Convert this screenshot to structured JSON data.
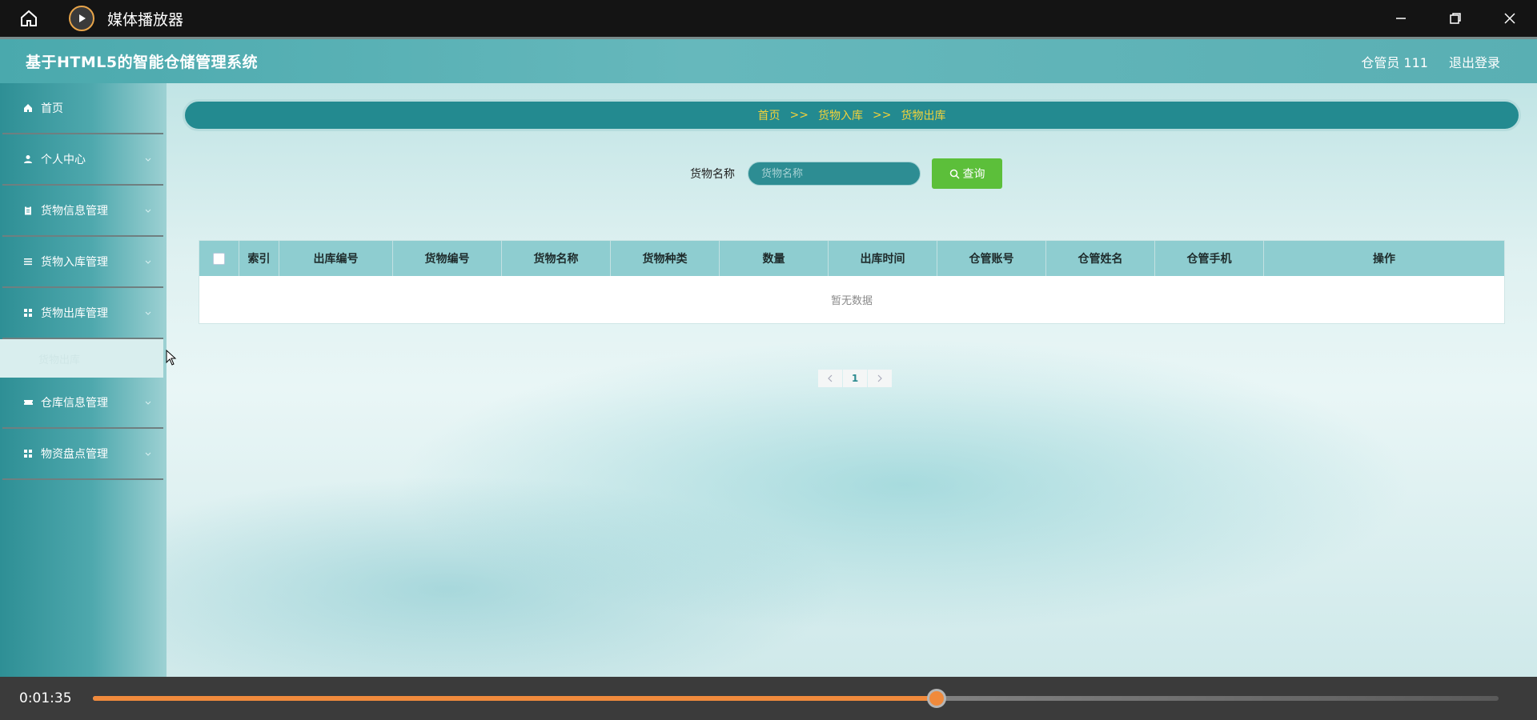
{
  "player": {
    "title": "媒体播放器",
    "time": "0:01:35",
    "progress": 0.6
  },
  "header": {
    "title": "基于HTML5的智能仓储管理系统",
    "user": "仓管员 111",
    "logout": "退出登录"
  },
  "sidebar": {
    "items": [
      {
        "label": "首页",
        "icon": "home-icon"
      },
      {
        "label": "个人中心",
        "icon": "user-icon"
      },
      {
        "label": "货物信息管理",
        "icon": "clipboard-icon"
      },
      {
        "label": "货物入库管理",
        "icon": "list-icon"
      },
      {
        "label": "货物出库管理",
        "icon": "grid-icon"
      },
      {
        "label": "仓库信息管理",
        "icon": "ticket-icon"
      },
      {
        "label": "物资盘点管理",
        "icon": "grid-icon"
      }
    ],
    "sub_item": "货物出库"
  },
  "breadcrumb": {
    "home": "首页",
    "sep": ">>",
    "level1": "货物入库",
    "level2": "货物出库"
  },
  "search": {
    "label": "货物名称",
    "placeholder": "货物名称",
    "button": "查询"
  },
  "table": {
    "columns": [
      "索引",
      "出库编号",
      "货物编号",
      "货物名称",
      "货物种类",
      "数量",
      "出库时间",
      "仓管账号",
      "仓管姓名",
      "仓管手机",
      "操作"
    ],
    "empty": "暂无数据"
  },
  "pagination": {
    "page": "1"
  },
  "colors": {
    "accent": "#238a90",
    "breadcrumb_text": "#f2d23a",
    "search_button": "#5cbf3a",
    "player_progress": "#f08a3c"
  }
}
